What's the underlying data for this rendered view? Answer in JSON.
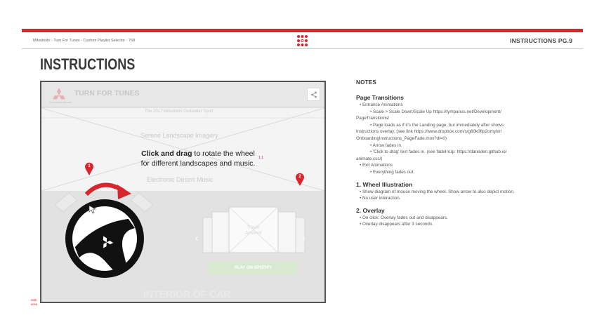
{
  "header": {
    "doc_label": "Mitsubishi - Turn For Tunes - Custom Playlist Selector - 768",
    "page_label": "INSTRUCTIONS PG.9"
  },
  "title": "INSTRUCTIONS",
  "colors": {
    "accent": "#d8262e"
  },
  "mockup": {
    "app_title": "TURN FOR TUNES",
    "logo_sub": "MITSUBISHI MOTORS",
    "share_icon": "share-icon",
    "subtitle": "The 2017 Mitsubishi Outlander Sport",
    "landscape_label_1": "Serene Landscape Imagery",
    "landscape_label_2": "Electronic Desert Music",
    "overlay_bold": "Click and drag",
    "overlay_rest": " to rotate the wheel",
    "overlay_line2": "for different landscapes and music.",
    "note_1_1": "1.1",
    "marker_1": "1",
    "marker_2": "2",
    "card_text_1": "Track",
    "card_text_2": "Artwork",
    "spotify_button": "PLAY ON SPOTIFY",
    "car_label": "INTERIOR OF CAR"
  },
  "safe_area": [
    "safe",
    "area"
  ],
  "notes": {
    "heading": "NOTES",
    "sections": [
      {
        "title": "Page Transitions",
        "lines": [
          {
            "level": 1,
            "text": "• Entrance Animations"
          },
          {
            "level": 2,
            "text": "• Scale > Scale Down/Scale Up https://tympanus.net/Development/"
          },
          {
            "level": 0,
            "text": "PageTransitions/"
          },
          {
            "level": 2,
            "text": "• Page loads as if it's the Landing page, but immediately after shows"
          },
          {
            "level": 0,
            "text": "Instructions overlay. (see link https://www.dropbox.com/s/g60k0ftp2omylxr/"
          },
          {
            "level": 0,
            "text": "OnboardingInstructions_PageFade.mov?dl=0)"
          },
          {
            "level": 2,
            "text": "• Arrow fades in."
          },
          {
            "level": 2,
            "text": "• 'Click to drag' text fades in. (see fadeInUp: https://daneden.github.io/"
          },
          {
            "level": 0,
            "text": "animate.css/)"
          },
          {
            "level": 1,
            "text": "• Exit Animations"
          },
          {
            "level": 2,
            "text": "• Everything fades out."
          }
        ]
      },
      {
        "title": "1. Wheel Illustration",
        "lines": [
          {
            "level": 1,
            "text": "• Show diagram of mouse moving the wheel. Show arrow to also depict motion."
          },
          {
            "level": 1,
            "text": "• No user interaction."
          }
        ]
      },
      {
        "title": "2. Overlay",
        "lines": [
          {
            "level": 1,
            "text": "• On click: Overlay fades out and disappears."
          },
          {
            "level": 1,
            "text": "• Overlay disappears after 3 seconds."
          }
        ]
      }
    ]
  }
}
